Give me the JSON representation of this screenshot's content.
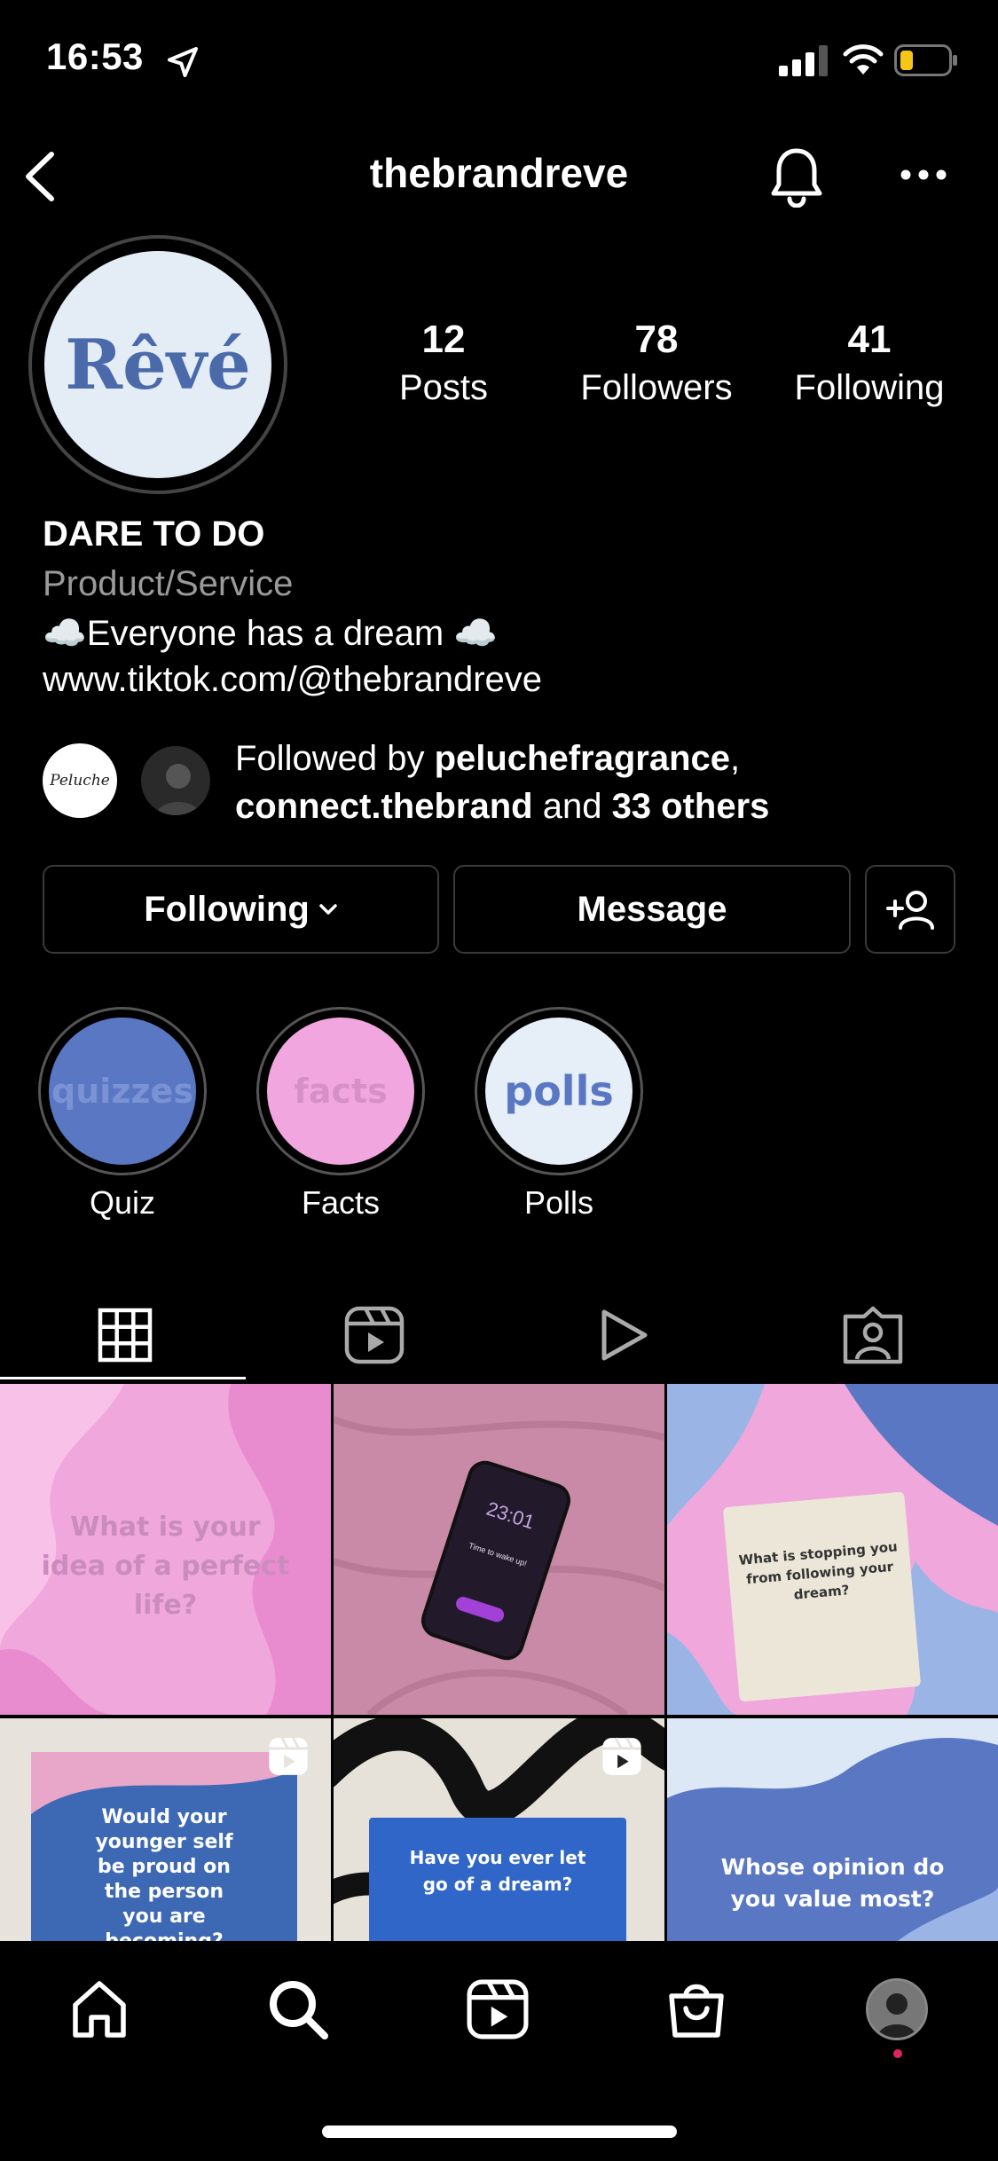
{
  "status_bar": {
    "time": "16:53"
  },
  "header": {
    "username": "thebrandreve"
  },
  "profile": {
    "avatar_text": "Rêvé",
    "stats": [
      {
        "value": "12",
        "label": "Posts"
      },
      {
        "value": "78",
        "label": "Followers"
      },
      {
        "value": "41",
        "label": "Following"
      }
    ],
    "name": "DARE TO DO",
    "category": "Product/Service",
    "bio": "☁️Everyone has a dream ☁️",
    "link": "www.tiktok.com/@thebrandreve",
    "followed_by": {
      "prefix": "Followed by ",
      "user1": "peluchefragrance",
      "sep": ",",
      "user2": "connect.thebrand",
      "mid": " and ",
      "others": "33 others",
      "avatar1_text": "Peluche"
    }
  },
  "buttons": {
    "following": "Following",
    "message": "Message"
  },
  "highlights": [
    {
      "cover": "quizzes",
      "label": "Quiz",
      "bg": "#5a77c4",
      "fg": "#7b93d4"
    },
    {
      "cover": "facts",
      "label": "Facts",
      "bg": "#f2a6df",
      "fg": "#d690c6"
    },
    {
      "cover": "polls",
      "label": "Polls",
      "bg": "#e6eef8",
      "fg": "#5a77c4"
    }
  ],
  "tabs": [
    "grid-icon",
    "reels-icon",
    "video-icon",
    "tagged-icon"
  ],
  "posts": [
    {
      "text": "What is your idea of a perfect life?"
    },
    {
      "text": "23:01",
      "sub": "Time to wake up!"
    },
    {
      "text": "What is stopping you from following your dream?"
    },
    {
      "text": "Would your younger self be proud on the person you are becoming?"
    },
    {
      "text": "Have you ever let go of a dream?"
    },
    {
      "text": "Whose opinion do you value most?"
    }
  ],
  "colors": {
    "accent_blue": "#5a77c4",
    "accent_pink": "#f2a6df",
    "notification_dot": "#e0245e"
  }
}
